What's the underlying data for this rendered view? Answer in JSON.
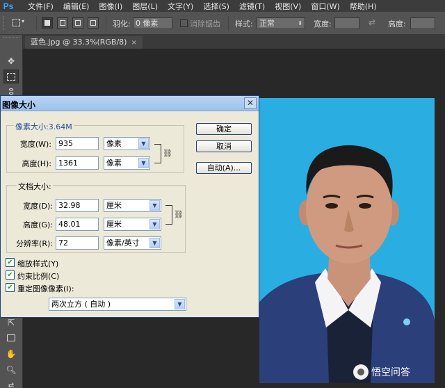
{
  "app": {
    "logo": "Ps"
  },
  "menu": [
    "文件(F)",
    "编辑(E)",
    "图像(I)",
    "图层(L)",
    "文字(Y)",
    "选择(S)",
    "滤镜(T)",
    "视图(V)",
    "窗口(W)",
    "帮助(H)"
  ],
  "options": {
    "feather_label": "羽化:",
    "feather_value": "0 像素",
    "antialias_label": "消除锯齿",
    "style_label": "样式:",
    "style_value": "正常",
    "width_label": "宽度:",
    "height_label": "高度:"
  },
  "document_tab": {
    "title": "蓝色.jpg @ 33.3%(RGB/8)",
    "close": "×"
  },
  "dialog": {
    "title": "图像大小",
    "close": "✕",
    "pixel_dimensions": {
      "legend": "像素大小:3.64M",
      "width_label": "宽度(W):",
      "width_value": "935",
      "width_unit": "像素",
      "height_label": "高度(H):",
      "height_value": "1361",
      "height_unit": "像素"
    },
    "document_size": {
      "legend": "文档大小:",
      "width_label": "宽度(D):",
      "width_value": "32.98",
      "width_unit": "厘米",
      "height_label": "高度(G):",
      "height_value": "48.01",
      "height_unit": "厘米",
      "resolution_label": "分辨率(R):",
      "resolution_value": "72",
      "resolution_unit": "像素/英寸"
    },
    "buttons": {
      "ok": "确定",
      "cancel": "取消",
      "auto": "自动(A)..."
    },
    "checkboxes": {
      "scale_styles": "缩放样式(Y)",
      "constrain": "约束比例(C)",
      "resample": "重定图像像素(I):"
    },
    "checkmark": "✔",
    "resample_method": "两次立方 ( 自动 )"
  },
  "watermark": {
    "text": "悟空问答"
  },
  "colors": {
    "photo_background": "#2aaee2",
    "suit": "#2b3f7a"
  }
}
